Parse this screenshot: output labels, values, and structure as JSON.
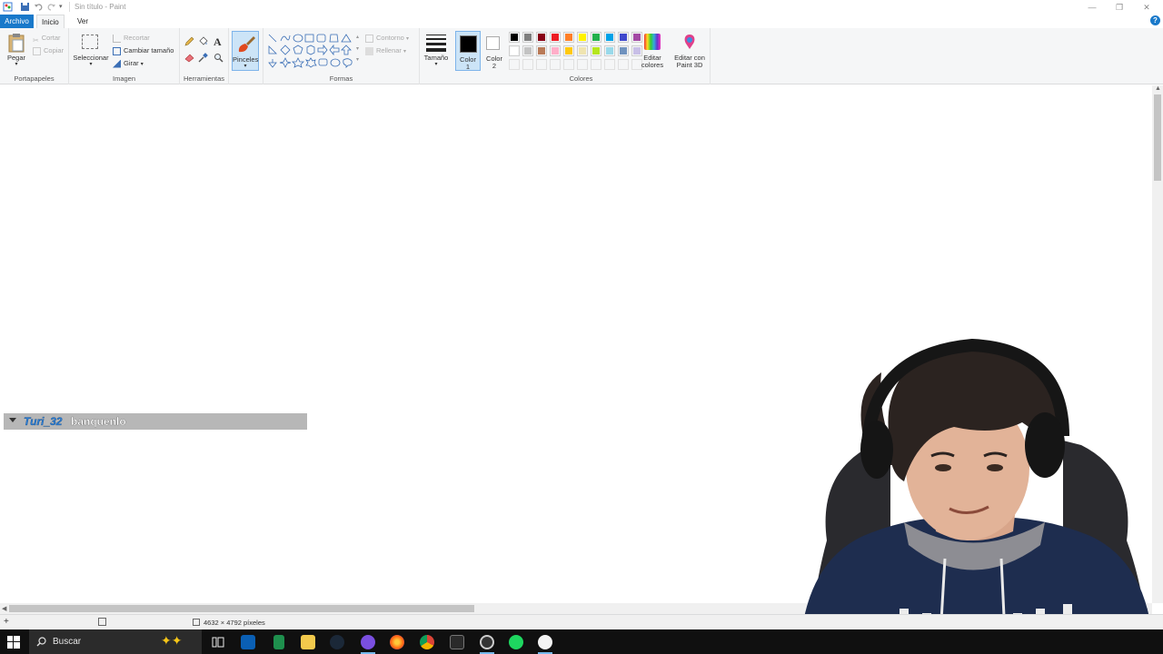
{
  "window": {
    "title": "Sin título - Paint"
  },
  "tabs": {
    "file": "Archivo",
    "home": "Inicio",
    "view": "Ver"
  },
  "ribbon": {
    "clipboard": {
      "label": "Portapapeles",
      "paste": "Pegar",
      "cut": "Cortar",
      "copy": "Copiar"
    },
    "image": {
      "label": "Imagen",
      "select": "Seleccionar",
      "crop": "Recortar",
      "resize": "Cambiar tamaño",
      "rotate": "Girar"
    },
    "tools": {
      "label": "Herramientas"
    },
    "brushes": {
      "label": "Pinceles"
    },
    "shapes": {
      "label": "Formas",
      "outline": "Contorno",
      "fill": "Rellenar"
    },
    "size": {
      "label": "Tamaño"
    },
    "color1": {
      "line1": "Color",
      "line2": "1"
    },
    "color2": {
      "line1": "Color",
      "line2": "2"
    },
    "colors": {
      "label": "Colores",
      "palette": [
        "#000000",
        "#7f7f7f",
        "#880015",
        "#ed1c24",
        "#ff7f27",
        "#fff200",
        "#22b14c",
        "#00a2e8",
        "#3f48cc",
        "#a349a4",
        "#ffffff",
        "#c3c3c3",
        "#b97a57",
        "#ffaec9",
        "#ffc90e",
        "#efe4b0",
        "#b5e61d",
        "#99d9ea",
        "#7092be",
        "#c8bfe7"
      ]
    },
    "edit_colors": {
      "line1": "Editar",
      "line2": "colores"
    },
    "paint3d": {
      "line1": "Editar con",
      "line2": "Paint 3D"
    }
  },
  "chat": {
    "user": "Turi_32",
    "message": "banquenlo"
  },
  "status": {
    "dimensions": "4632 × 4792 píxeles"
  },
  "taskbar": {
    "search_placeholder": "Buscar"
  }
}
